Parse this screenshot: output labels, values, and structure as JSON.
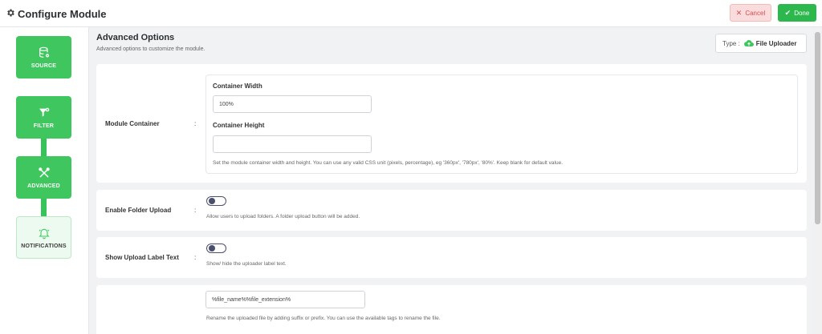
{
  "header": {
    "title": "Configure Module",
    "cancel_label": "Cancel",
    "done_label": "Done"
  },
  "sidebar": {
    "steps": [
      {
        "label": "SOURCE",
        "icon": "database-icon",
        "state": "active"
      },
      {
        "label": "FILTER",
        "icon": "filter-icon",
        "state": "active"
      },
      {
        "label": "ADVANCED",
        "icon": "tools-icon",
        "state": "active"
      },
      {
        "label": "NOTIFICATIONS",
        "icon": "bell-icon",
        "state": "inactive"
      }
    ]
  },
  "main": {
    "heading": "Advanced Options",
    "subheading": "Advanced options to customize the module.",
    "type_prefix": "Type :",
    "type_value": "File Uploader",
    "module_container": {
      "label": "Module Container",
      "colon": ":",
      "width_label": "Container Width",
      "width_value": "100%",
      "height_label": "Container Height",
      "height_value": "",
      "help": "Set the module container width and height. You can use any valid CSS unit (pixels, percentage), eg '360px', '780px', '80%'. Keep blank for default value."
    },
    "folder_upload": {
      "label": "Enable Folder Upload",
      "colon": ":",
      "help": "Allow users to upload folders. A folder upload button will be added."
    },
    "upload_label": {
      "label": "Show Upload Label Text",
      "colon": ":",
      "help": "Show/ hide the uploader label text."
    },
    "rename": {
      "value": "%file_name%%file_extension%",
      "help": "Rename the uploaded file by adding suffix or prefix. You can use the available tags to rename the file."
    }
  },
  "colors": {
    "primary_green": "#3fc65f",
    "cancel_red": "#d94a52",
    "toggle_dark": "#4a4f6b"
  }
}
